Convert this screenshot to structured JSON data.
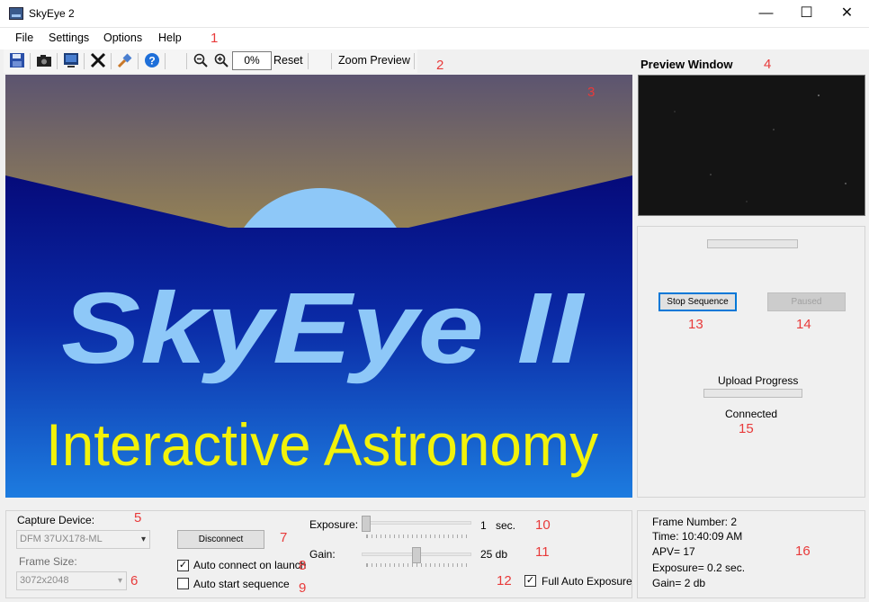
{
  "window": {
    "title": "SkyEye 2",
    "minimize": "—",
    "maximize": "☐",
    "close": "✕"
  },
  "menu": [
    "File",
    "Settings",
    "Options",
    "Help"
  ],
  "toolbar": {
    "zoom_value": "0%",
    "reset_label": "Reset",
    "zoom_preview_label": "Zoom Preview",
    "icons": [
      "save-icon",
      "camera-icon",
      "monitor-icon",
      "tools-icon",
      "connect-icon",
      "help-icon",
      "zoom-out-icon",
      "zoom-in-icon"
    ]
  },
  "main_image": {
    "title": "SkyEye II",
    "subtitle": "Interactive Astronomy"
  },
  "preview": {
    "title": "Preview Window"
  },
  "sequence": {
    "stop_label": "Stop Sequence",
    "paused_label": "Paused",
    "upload_label": "Upload Progress",
    "status": "Connected"
  },
  "capture": {
    "device_label": "Capture Device:",
    "device_value": "DFM 37UX178-ML",
    "frame_size_label": "Frame Size:",
    "frame_size_value": "3072x2048",
    "disconnect_label": "Disconnect",
    "auto_connect_label": "Auto connect on launch",
    "auto_connect_checked": true,
    "auto_start_label": "Auto start sequence",
    "auto_start_checked": false
  },
  "exposure": {
    "label": "Exposure:",
    "value": "1",
    "unit": "sec.",
    "gain_label": "Gain:",
    "gain_value": "25 db",
    "exposure_level": 0.0,
    "gain_level": 0.5,
    "full_auto_label": "Full Auto Exposure",
    "full_auto_checked": true
  },
  "stats": {
    "frame_number": "Frame Number: 2",
    "time": "Time: 10:40:09 AM",
    "apv": "APV= 17",
    "exposure": "Exposure= 0.2 sec.",
    "gain": "Gain= 2 db"
  },
  "annotations": [
    "1",
    "2",
    "3",
    "4",
    "5",
    "6",
    "7",
    "8",
    "9",
    "10",
    "11",
    "12",
    "13",
    "14",
    "15",
    "16"
  ],
  "colors": {
    "accent": "#0078d7",
    "annotation": "#e83a3a",
    "sky_blue": "#0a1a8c",
    "text_yellow": "#f2f20a",
    "logo_blue": "#8ec8f8"
  }
}
